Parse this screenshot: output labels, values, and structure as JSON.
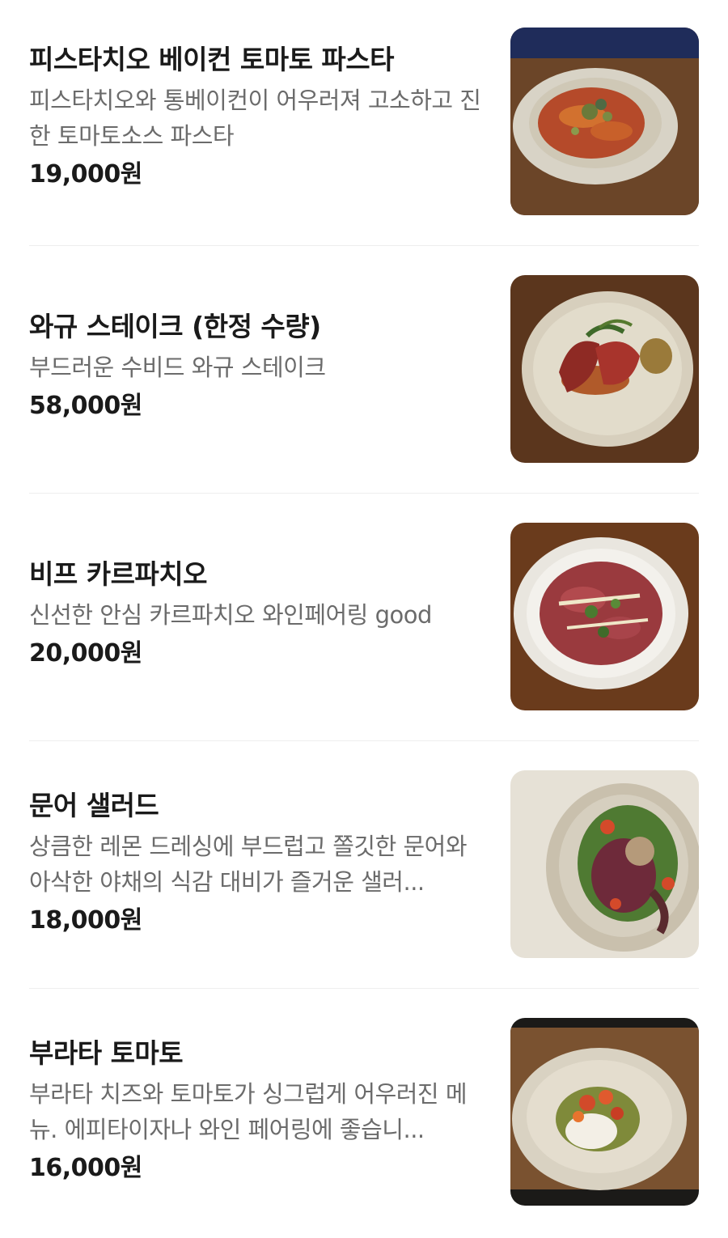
{
  "menu": {
    "items": [
      {
        "name": "피스타치오 베이컨 토마토 파스타",
        "description": "피스타치오와 통베이컨이 어우러져 고소하고 진한 토마토소스 파스타",
        "price": "19,000원",
        "photo_alt": "pistachio-bacon-tomato-pasta-photo"
      },
      {
        "name": "와규 스테이크 (한정 수량)",
        "description": "부드러운 수비드 와규 스테이크",
        "price": "58,000원",
        "photo_alt": "wagyu-steak-photo"
      },
      {
        "name": "비프 카르파치오",
        "description": "신선한 안심 카르파치오 와인페어링 good",
        "price": "20,000원",
        "photo_alt": "beef-carpaccio-photo"
      },
      {
        "name": "문어 샐러드",
        "description": "상큼한 레몬 드레싱에 부드럽고 쫄깃한 문어와 아삭한 야채의 식감 대비가 즐거운 샐러...",
        "price": "18,000원",
        "photo_alt": "octopus-salad-photo"
      },
      {
        "name": "부라타 토마토",
        "description": "부라타 치즈와 토마토가 싱그럽게 어우러진 메뉴. 에피타이자나 와인 페어링에 좋습니...",
        "price": "16,000원",
        "photo_alt": "burrata-tomato-photo"
      }
    ]
  }
}
